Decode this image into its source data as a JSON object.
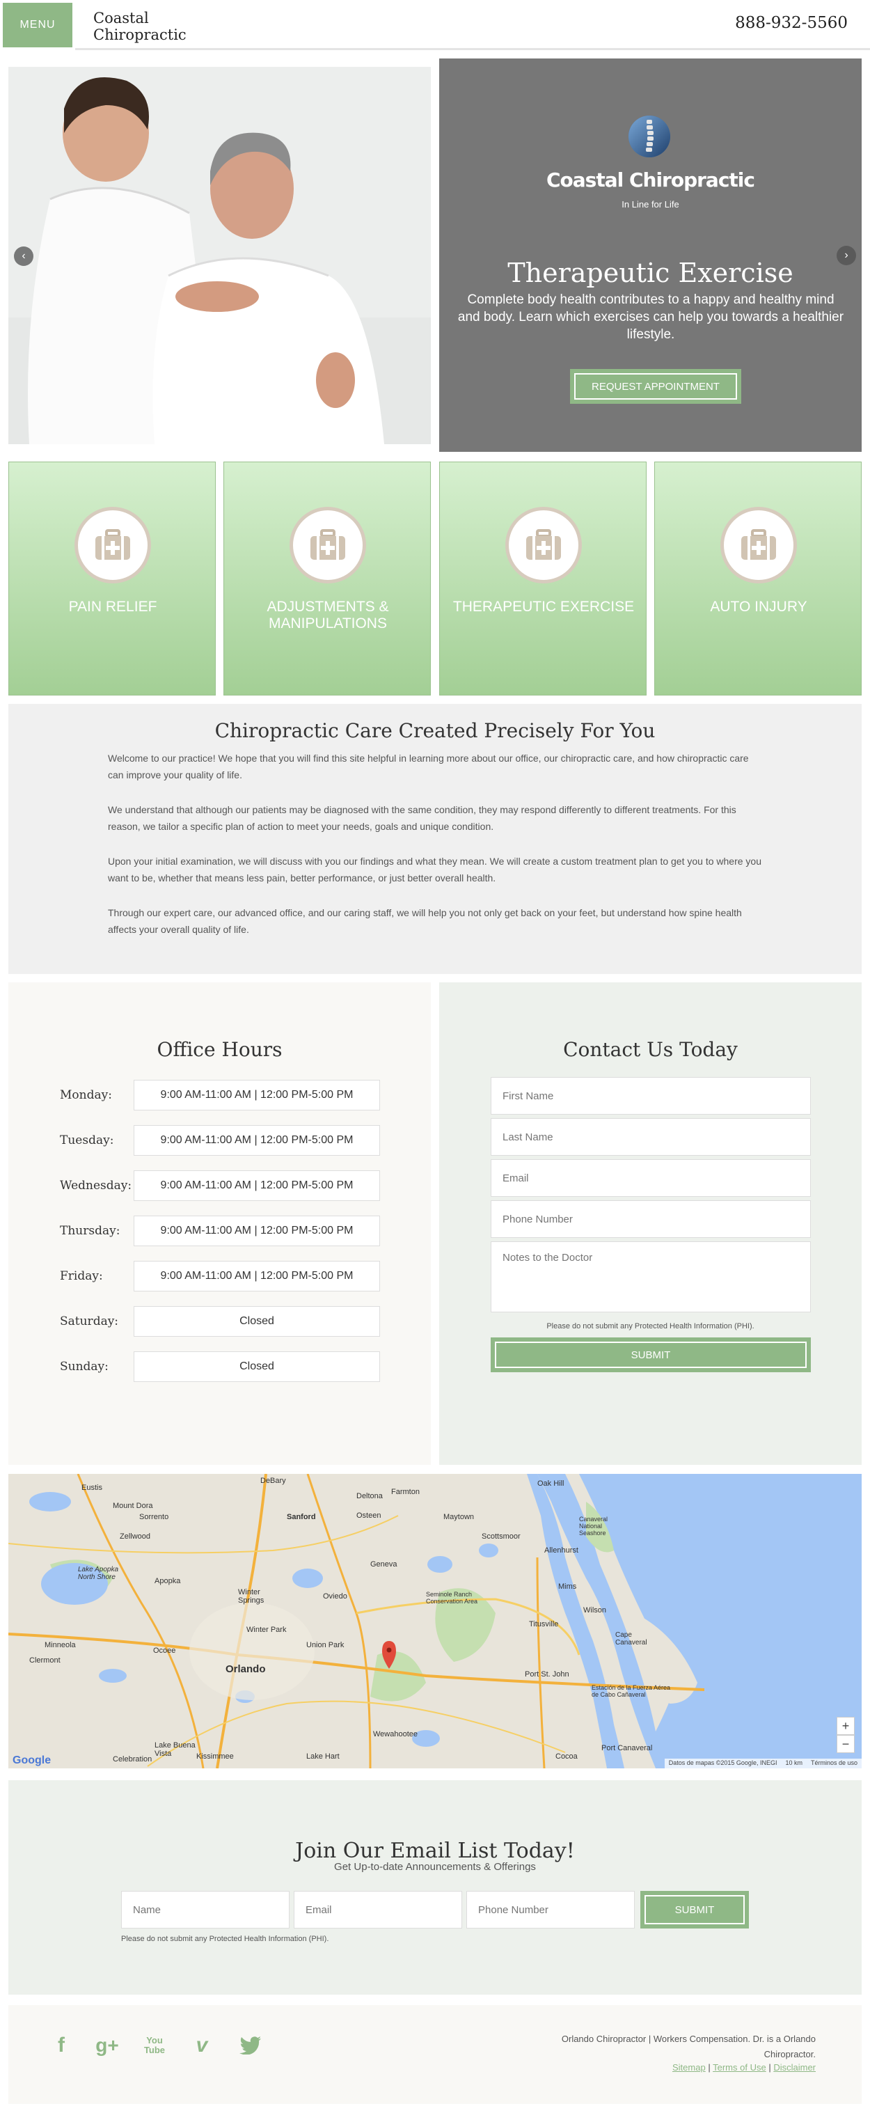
{
  "header": {
    "menu_label": "MENU",
    "logo_line1": "Coastal",
    "logo_line2": "Chiropractic",
    "phone": "888-932-5560"
  },
  "hero": {
    "brand_name": "Coastal Chiropractic",
    "brand_tagline": "In Line for Life",
    "title": "Therapeutic Exercise",
    "description": "Complete body health contributes to a happy and healthy mind and body. Learn which exercises can help you towards a healthier lifestyle.",
    "button_label": "REQUEST APPOINTMENT",
    "prev_icon": "chevron-left-icon",
    "next_icon": "chevron-right-icon"
  },
  "services": [
    {
      "label": "PAIN RELIEF",
      "icon": "first-aid-kit-icon"
    },
    {
      "label": "ADJUSTMENTS & MANIPULATIONS",
      "icon": "first-aid-kit-icon"
    },
    {
      "label": "THERAPEUTIC EXERCISE",
      "icon": "first-aid-kit-icon"
    },
    {
      "label": "AUTO INJURY",
      "icon": "first-aid-kit-icon"
    }
  ],
  "about": {
    "title": "Chiropractic Care Created Precisely For You",
    "paragraphs": [
      "Welcome to our practice! We hope that you will find this site helpful in learning more about our office, our chiropractic care, and how chiropractic care can improve your quality of life.",
      "We understand that although our patients may be diagnosed with the same condition, they may respond differently to different treatments. For this reason, we tailor a specific plan of action to meet your needs, goals and unique condition.",
      "Upon your initial examination, we will discuss with you our findings and what they mean. We will create a custom treatment plan to get you to where you want to be, whether that means less pain, better performance, or just better overall health.",
      "Through our expert care, our advanced office, and our caring staff, we will help you not only get back on your feet, but understand how spine health affects your overall quality of life."
    ]
  },
  "hours": {
    "title": "Office Hours",
    "rows": [
      {
        "day": "Monday:",
        "time": "9:00 AM-11:00 AM | 12:00 PM-5:00 PM"
      },
      {
        "day": "Tuesday:",
        "time": "9:00 AM-11:00 AM | 12:00 PM-5:00 PM"
      },
      {
        "day": "Wednesday:",
        "time": "9:00 AM-11:00 AM | 12:00 PM-5:00 PM"
      },
      {
        "day": "Thursday:",
        "time": "9:00 AM-11:00 AM | 12:00 PM-5:00 PM"
      },
      {
        "day": "Friday:",
        "time": "9:00 AM-11:00 AM | 12:00 PM-5:00 PM"
      },
      {
        "day": "Saturday:",
        "time": "Closed"
      },
      {
        "day": "Sunday:",
        "time": "Closed"
      }
    ]
  },
  "contact": {
    "title": "Contact Us Today",
    "first_name_placeholder": "First Name",
    "last_name_placeholder": "Last Name",
    "email_placeholder": "Email",
    "phone_placeholder": "Phone Number",
    "notes_placeholder": "Notes to the Doctor",
    "phi_notice": "Please do not submit any Protected Health Information (PHI).",
    "submit_label": "SUBMIT"
  },
  "map": {
    "labels": [
      "Eustis",
      "Mount Dora",
      "Sorrento",
      "DeBary",
      "Sanford",
      "Deltona",
      "Osteen",
      "Farmton",
      "Oak Hill",
      "Maytown",
      "Canaveral National Seashore",
      "Scottsmoor",
      "Allenhurst",
      "Zellwood",
      "Lake Apopka North Shore",
      "Apopka",
      "Winter Springs",
      "Oviedo",
      "Geneva",
      "Seminole Ranch Conservation Area",
      "Titusville",
      "Mims",
      "Minneola",
      "Clermont",
      "Ocoee",
      "Orlando",
      "Winter Park",
      "Union Park",
      "Wilson",
      "Cape Canaveral",
      "Port St. John",
      "Estación de la Fuerza Aérea de Cabo Cañaveral",
      "Lake Buena Vista",
      "Kissimmee",
      "Wewahootee",
      "Port Canaveral",
      "Lake Hart",
      "Cocoa",
      "Celebration"
    ],
    "logo": "Google",
    "attribution": "Datos de mapas ©2015 Google, INEGI",
    "scale": "10 km",
    "terms": "Términos de uso",
    "zoom_in": "+",
    "zoom_out": "−"
  },
  "newsletter": {
    "title": "Join Our Email List Today!",
    "subtitle": "Get Up-to-date Announcements & Offerings",
    "name_placeholder": "Name",
    "email_placeholder": "Email",
    "phone_placeholder": "Phone Number",
    "submit_label": "SUBMIT",
    "phi_notice": "Please do not submit any Protected Health Information (PHI)."
  },
  "footer": {
    "social": [
      {
        "name": "facebook-icon",
        "glyph": "f"
      },
      {
        "name": "google-plus-icon",
        "glyph": "g+"
      },
      {
        "name": "youtube-icon",
        "glyph": "You Tube"
      },
      {
        "name": "vimeo-icon",
        "glyph": "v"
      },
      {
        "name": "twitter-icon",
        "glyph": "🐦"
      }
    ],
    "description": "Orlando Chiropractor | Workers Compensation. Dr. is a Orlando Chiropractor.",
    "links": [
      "Sitemap",
      "Terms of Use",
      "Disclaimer"
    ],
    "separator": "|"
  },
  "colors": {
    "accent": "#8fb886",
    "hero_panel": "#777777",
    "tile_top": "#d6f0cf",
    "tile_bottom": "#a3cf95"
  }
}
